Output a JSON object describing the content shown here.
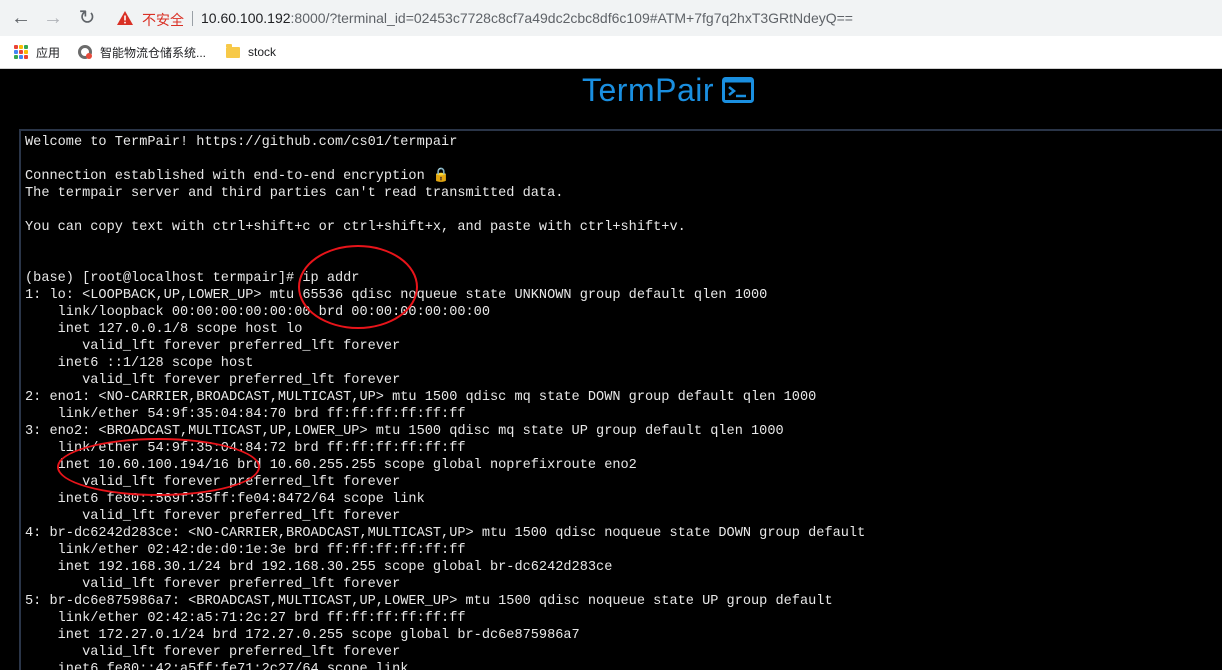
{
  "browser": {
    "insecure_label": "不安全",
    "url_host": "10.60.100.192",
    "url_rest": ":8000/?terminal_id=02453c7728c8cf7a49dc2cbc8df6c109#ATM+7fg7q2hxT3GRtNdeyQ==",
    "bookmarks": [
      {
        "label": "应用",
        "icon": "apps-grid-icon"
      },
      {
        "label": "智能物流仓储系统...",
        "icon": "site-icon"
      },
      {
        "label": "stock",
        "icon": "folder-icon"
      }
    ]
  },
  "app": {
    "logo_text": "TermPair",
    "accent_color": "#1a8fe0"
  },
  "terminal": {
    "lines": [
      "Welcome to TermPair! https://github.com/cs01/termpair",
      "",
      "Connection established with end-to-end encryption 🔒",
      "The termpair server and third parties can't read transmitted data.",
      "",
      "You can copy text with ctrl+shift+c or ctrl+shift+x, and paste with ctrl+shift+v.",
      "",
      "",
      "(base) [root@localhost termpair]# ip addr",
      "1: lo: <LOOPBACK,UP,LOWER_UP> mtu 65536 qdisc noqueue state UNKNOWN group default qlen 1000",
      "    link/loopback 00:00:00:00:00:00 brd 00:00:00:00:00:00",
      "    inet 127.0.0.1/8 scope host lo",
      "       valid_lft forever preferred_lft forever",
      "    inet6 ::1/128 scope host",
      "       valid_lft forever preferred_lft forever",
      "2: eno1: <NO-CARRIER,BROADCAST,MULTICAST,UP> mtu 1500 qdisc mq state DOWN group default qlen 1000",
      "    link/ether 54:9f:35:04:84:70 brd ff:ff:ff:ff:ff:ff",
      "3: eno2: <BROADCAST,MULTICAST,UP,LOWER_UP> mtu 1500 qdisc mq state UP group default qlen 1000",
      "    link/ether 54:9f:35:04:84:72 brd ff:ff:ff:ff:ff:ff",
      "    inet 10.60.100.194/16 brd 10.60.255.255 scope global noprefixroute eno2",
      "       valid_lft forever preferred_lft forever",
      "    inet6 fe80::569f:35ff:fe04:8472/64 scope link",
      "       valid_lft forever preferred_lft forever",
      "4: br-dc6242d283ce: <NO-CARRIER,BROADCAST,MULTICAST,UP> mtu 1500 qdisc noqueue state DOWN group default",
      "    link/ether 02:42:de:d0:1e:3e brd ff:ff:ff:ff:ff:ff",
      "    inet 192.168.30.1/24 brd 192.168.30.255 scope global br-dc6242d283ce",
      "       valid_lft forever preferred_lft forever",
      "5: br-dc6e875986a7: <BROADCAST,MULTICAST,UP,LOWER_UP> mtu 1500 qdisc noqueue state UP group default",
      "    link/ether 02:42:a5:71:2c:27 brd ff:ff:ff:ff:ff:ff",
      "    inet 172.27.0.1/24 brd 172.27.0.255 scope global br-dc6e875986a7",
      "       valid_lft forever preferred_lft forever",
      "    inet6 fe80::42:a5ff:fe71:2c27/64 scope link"
    ]
  },
  "annotation_color": "#e8141a"
}
